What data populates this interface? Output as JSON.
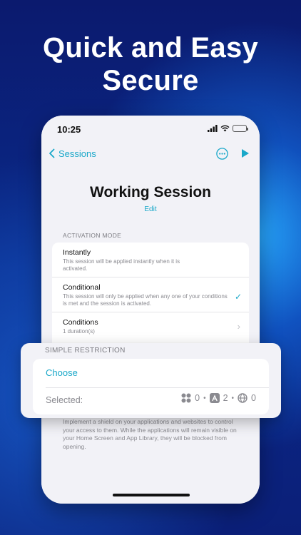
{
  "headline": {
    "line1": "Quick and Easy",
    "line2": "Secure"
  },
  "status_bar": {
    "time": "10:25"
  },
  "nav": {
    "back_label": "Sessions"
  },
  "session": {
    "title": "Working Session",
    "edit_label": "Edit"
  },
  "activation": {
    "section_label": "ACTIVATION MODE",
    "items": [
      {
        "title": "Instantly",
        "subtitle": "This session will be applied instantly when it is activated."
      },
      {
        "title": "Conditional",
        "subtitle": "This session will only be applied when any one of your conditions is met and the session is activated."
      },
      {
        "title": "Conditions",
        "subtitle": "1 duration(s)"
      }
    ]
  },
  "restriction": {
    "section_label": "SIMPLE RESTRICTION",
    "choose_label": "Choose",
    "selected_label": "Selected:",
    "apps_count": "0",
    "categories_count": "2",
    "web_count": "0"
  },
  "footer_note": "Implement a shield on your applications and websites to control your access to them. While the applications will remain visible on your Home Screen and App Library, they will be blocked from opening.",
  "colors": {
    "accent": "#1aa8c9",
    "background_top": "#0b1a6e",
    "background_glow": "#28aaff"
  }
}
